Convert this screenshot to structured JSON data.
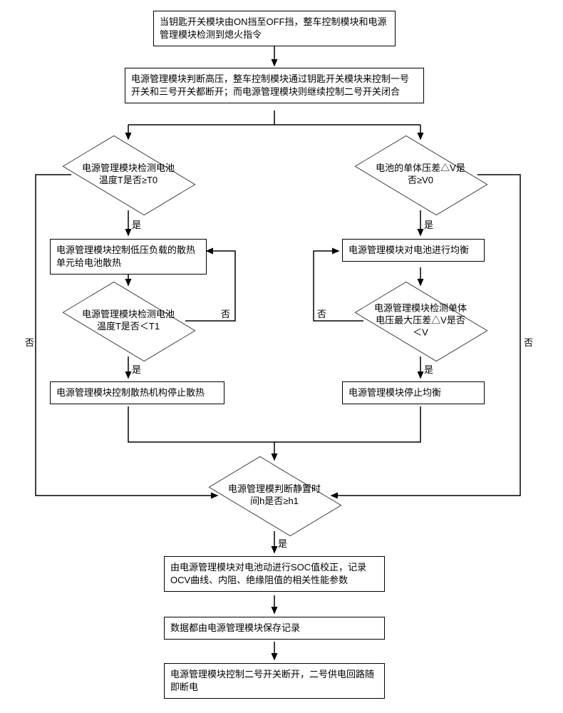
{
  "flow": {
    "step1": "当钥匙开关模块由ON挡至OFF挡，整车控制模块和电源管理模块检测到熄火指令",
    "step2": "电源管理模块判断高压，整车控制模块通过钥匙开关模块来控制一号开关和三号开关都断开；而电源管理模块则继续控制二号开关闭合",
    "decisionTemp": "电源管理模块检测电池温度T是否≥T0",
    "decisionVolt": "电池的单体压差△V是否≥V0",
    "leftAction1": "电源管理模块控制低压负载的散热单元给电池散热",
    "leftDecision2": "电源管理模块检测电池温度T是否＜T1",
    "leftAction2": "电源管理模块控制散热机构停止散热",
    "rightAction1": "电源管理模块对电池进行均衡",
    "rightDecision2": "电源管理模块检测单体电压最大压差△V是否＜V",
    "rightAction2": "电源管理模块停止均衡",
    "decisionTime": "电源管理模判断静置时间h是否≥h1",
    "step3": "由电源管理模块对电池动进行SOC值校正，记录OCV曲线、内阻、绝缘阻值的相关性能参数",
    "step4": "数据都由电源管理模块保存记录",
    "step5": "电源管理模块控制二号开关断开，二号供电回路随即断电"
  },
  "labels": {
    "yes": "是",
    "no": "否"
  }
}
